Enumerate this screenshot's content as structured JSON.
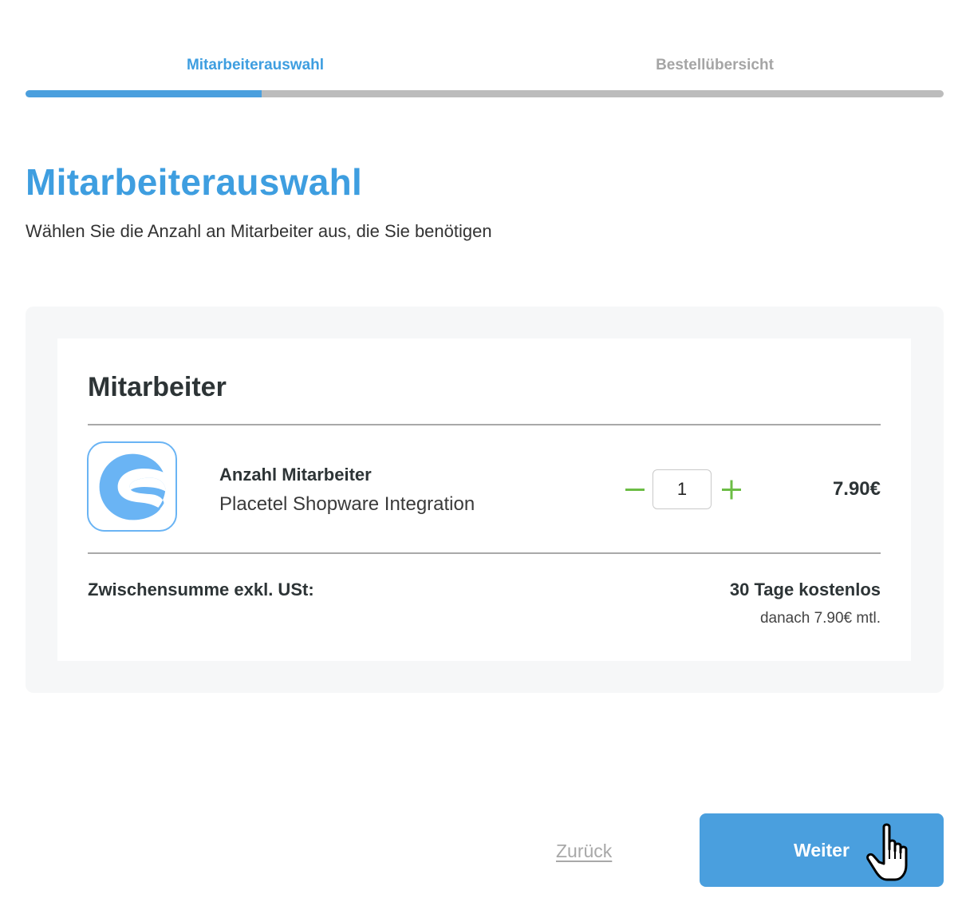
{
  "steps": {
    "items": [
      {
        "label": "Mitarbeiterauswahl",
        "state": "active"
      },
      {
        "label": "Bestellübersicht",
        "state": "inactive"
      }
    ],
    "progress_fraction": 0.257
  },
  "header": {
    "title": "Mitarbeiterauswahl",
    "subtitle": "Wählen Sie die Anzahl an Mitarbeiter aus, die Sie benötigen"
  },
  "card": {
    "title": "Mitarbeiter",
    "product": {
      "logo_icon": "shopware-logo-icon",
      "name": "Anzahl Mitarbeiter",
      "description": "Placetel Shopware Integration",
      "quantity": "1",
      "price": "7.90€"
    },
    "subtotal": {
      "label": "Zwischensumme exkl. USt:",
      "value": "30 Tage kostenlos",
      "note": "danach 7.90€ mtl."
    }
  },
  "footer": {
    "back_label": "Zurück",
    "next_label": "Weiter"
  },
  "colors": {
    "accent": "#3e9ee0",
    "button": "#4a9fde",
    "stepper": "#6cbd45",
    "logo": "#6ab4f4"
  }
}
